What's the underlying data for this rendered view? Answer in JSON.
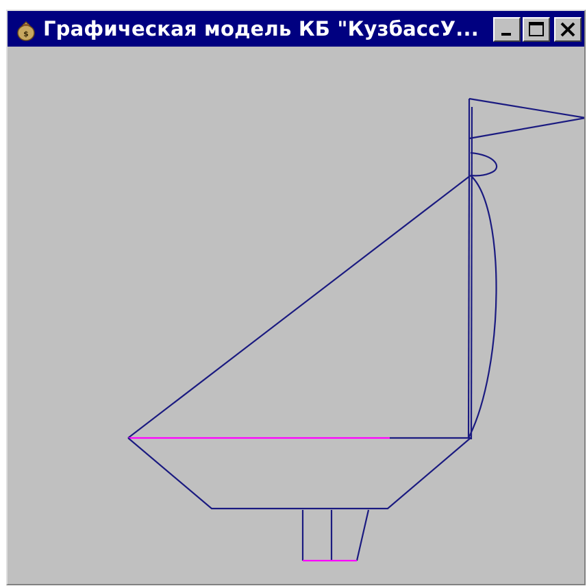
{
  "window": {
    "title": "Графическая модель КБ \"КузбассУ...",
    "icon": "money-bag-icon",
    "buttons": {
      "minimize": "minimize-icon",
      "maximize": "maximize-icon",
      "close": "close-icon"
    }
  },
  "drawing": {
    "line_color": "#1a1a80",
    "accent_color": "#ff00ff",
    "background": "#c0c0c0"
  }
}
